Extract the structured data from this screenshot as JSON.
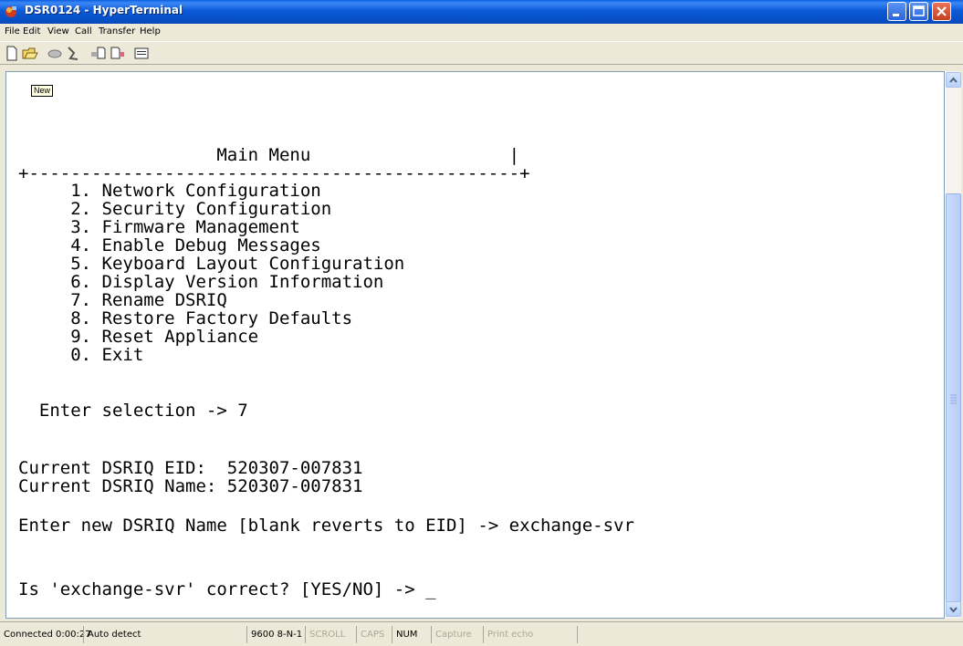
{
  "window": {
    "title": "DSR0124 - HyperTerminal"
  },
  "menubar": {
    "items": [
      "File",
      "Edit",
      "View",
      "Call",
      "Transfer",
      "Help"
    ]
  },
  "toolbar": {
    "icons": [
      "new-icon",
      "open-icon",
      "disconnect-icon",
      "call-icon",
      "send-icon",
      "receive-icon",
      "properties-icon"
    ]
  },
  "terminal": {
    "tooltip": "New",
    "lines": [
      "                   Main Menu                   |",
      "+-----------------------------------------------+",
      "",
      "     1. Network Configuration",
      "     2. Security Configuration",
      "     3. Firmware Management",
      "     4. Enable Debug Messages",
      "     5. Keyboard Layout Configuration",
      "     6. Display Version Information",
      "     7. Rename DSRIQ",
      "     8. Restore Factory Defaults",
      "     9. Reset Appliance",
      "     0. Exit",
      "",
      "  Enter selection -> 7",
      "",
      "",
      "Current DSRIQ EID:  520307-007831",
      "Current DSRIQ Name: 520307-007831",
      "",
      "Enter new DSRIQ Name [blank reverts to EID] -> exchange-svr",
      "",
      "",
      "Is 'exchange-svr' correct? [YES/NO] -> _"
    ]
  },
  "statusbar": {
    "connected": "Connected 0:00:27",
    "detect": "Auto detect",
    "settings": "9600 8-N-1",
    "scroll": "SCROLL",
    "caps": "CAPS",
    "num": "NUM",
    "capture": "Capture",
    "print_echo": "Print echo"
  },
  "colors": {
    "titlebar": "#0a5fe0",
    "terminal_bg": "#ffffff",
    "chrome": "#ece9d8"
  }
}
